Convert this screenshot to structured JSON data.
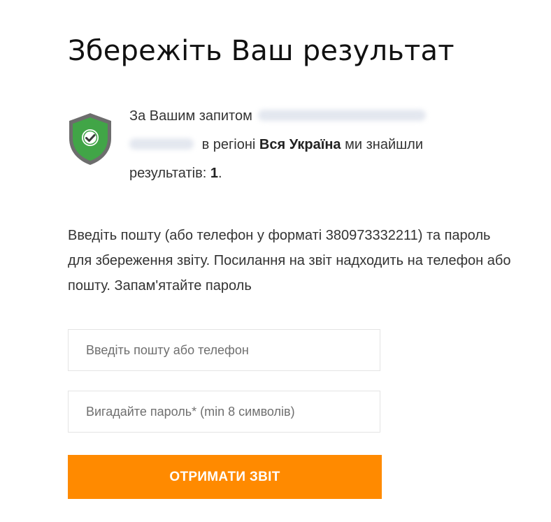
{
  "page": {
    "title": "Збережіть Ваш результат"
  },
  "result": {
    "prefix": "За Вашим запитом",
    "region_prefix": "в регіоні",
    "region": "Вся Україна",
    "found_suffix": "ми знайшли",
    "results_label": "результатів:",
    "results_count": "1",
    "results_end": ".",
    "icon": "shield-check-icon",
    "icon_colors": {
      "outer": "#6d6d6d",
      "inner": "#41a547",
      "check_circle": "#ffffff",
      "check": "#3a3a3a"
    }
  },
  "instructions": {
    "text": "Введіть пошту (або телефон у форматі 380973332211) та пароль для збереження звіту. Посилання на звіт надходить на телефон або пошту. Запам'ятайте пароль"
  },
  "form": {
    "email_placeholder": "Введіть пошту або телефон",
    "email_value": "",
    "password_placeholder": "Вигадайте пароль* (min 8 символів)",
    "password_value": "",
    "submit_label": "ОТРИМАТИ ЗВІТ"
  },
  "colors": {
    "accent": "#ff8a00",
    "title": "#111111",
    "text": "#333333",
    "field_border": "#e4e4e4"
  }
}
